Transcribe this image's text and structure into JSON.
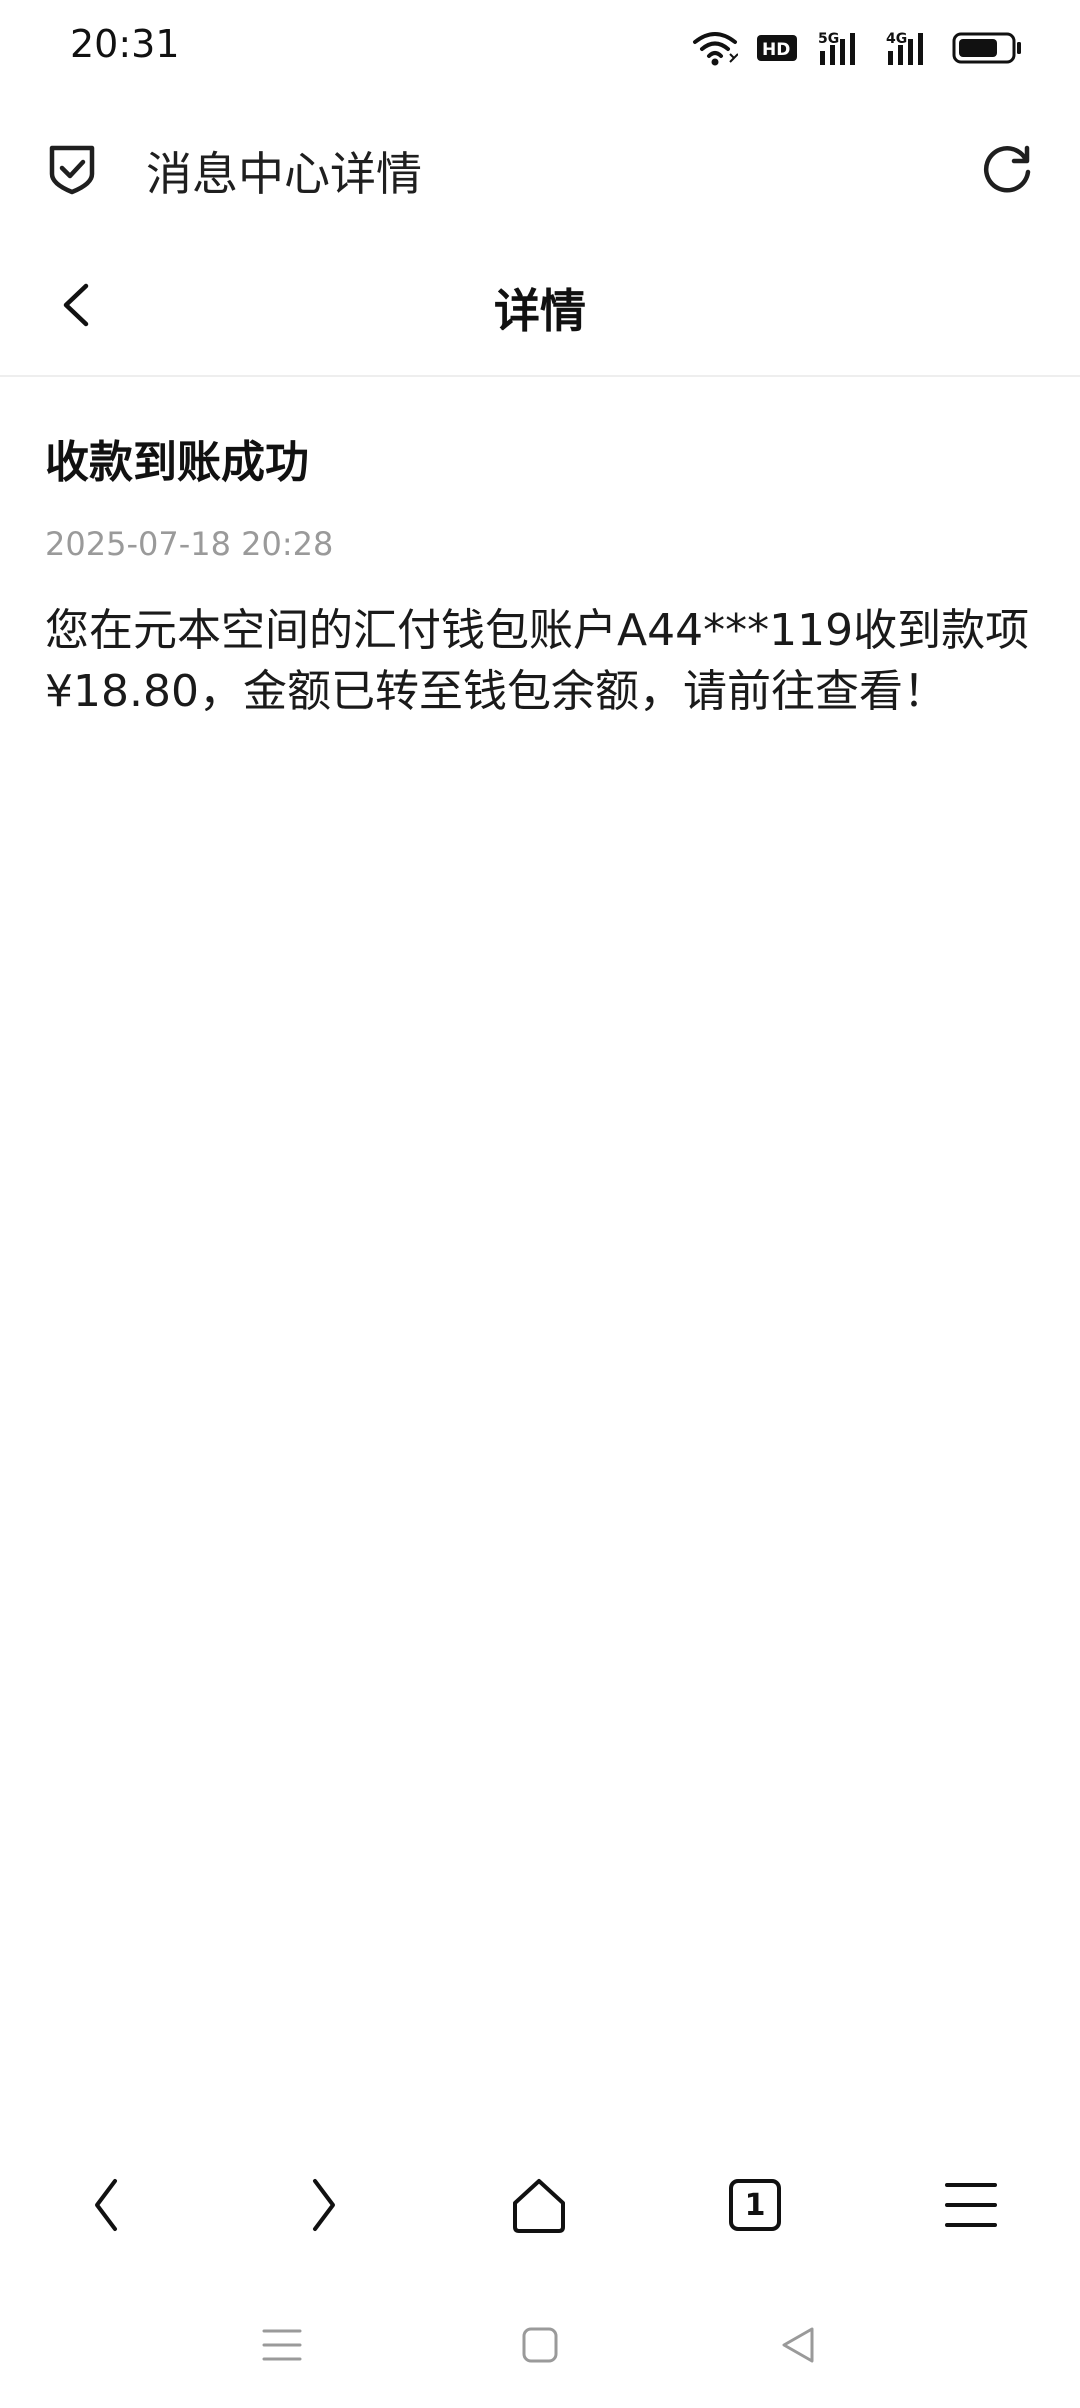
{
  "status_bar": {
    "time": "20:31",
    "icons": [
      "wifi-icon",
      "hd-icon",
      "signal-5g-icon",
      "signal-4g-icon",
      "battery-icon"
    ],
    "hd_label": "HD",
    "net1_label": "5G",
    "net2_label": "4G",
    "battery_level": 0.7
  },
  "address_bar": {
    "title": "消息中心详情"
  },
  "page": {
    "title": "详情"
  },
  "message": {
    "title": "收款到账成功",
    "timestamp": "2025-07-18 20:28",
    "body": "您在元本空间的汇付钱包账户A44***119收到款项¥18.80，金额已转至钱包余额，请前往查看！"
  },
  "toolbar": {
    "tab_count": "1"
  },
  "colors": {
    "text": "#1a1a1a",
    "muted": "#9a9a9a",
    "divider": "#eeeeee"
  }
}
